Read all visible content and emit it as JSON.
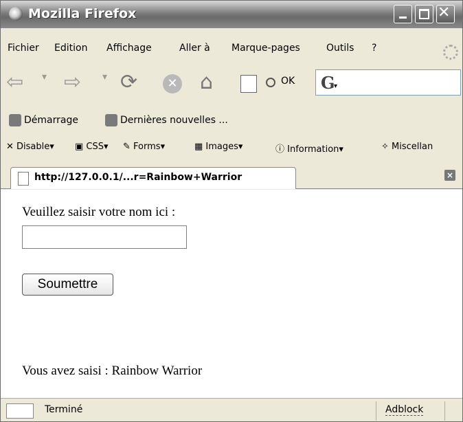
{
  "window": {
    "title": "Mozilla Firefox"
  },
  "menubar": {
    "items": [
      "Fichier",
      "Edition",
      "Affichage",
      "Aller à",
      "Marque-pages",
      "Outils",
      "?"
    ]
  },
  "navbar": {
    "go_label": "OK",
    "search_logo": "G"
  },
  "bookmarks": {
    "items": [
      "Démarrage",
      "Dernières nouvelles ..."
    ]
  },
  "devtoolbar": {
    "items": [
      "Disable",
      "CSS",
      "Forms",
      "Images",
      "Information",
      "Miscellan"
    ]
  },
  "tab": {
    "label": "http://127.0.0.1/...r=Rainbow+Warrior",
    "close": "×"
  },
  "page": {
    "prompt": "Veuillez saisir votre nom ici :",
    "input_value": "",
    "submit_label": "Soumettre",
    "result": "Vous avez saisi : Rainbow Warrior"
  },
  "status": {
    "text": "Terminé",
    "adblock": "Adblock"
  }
}
